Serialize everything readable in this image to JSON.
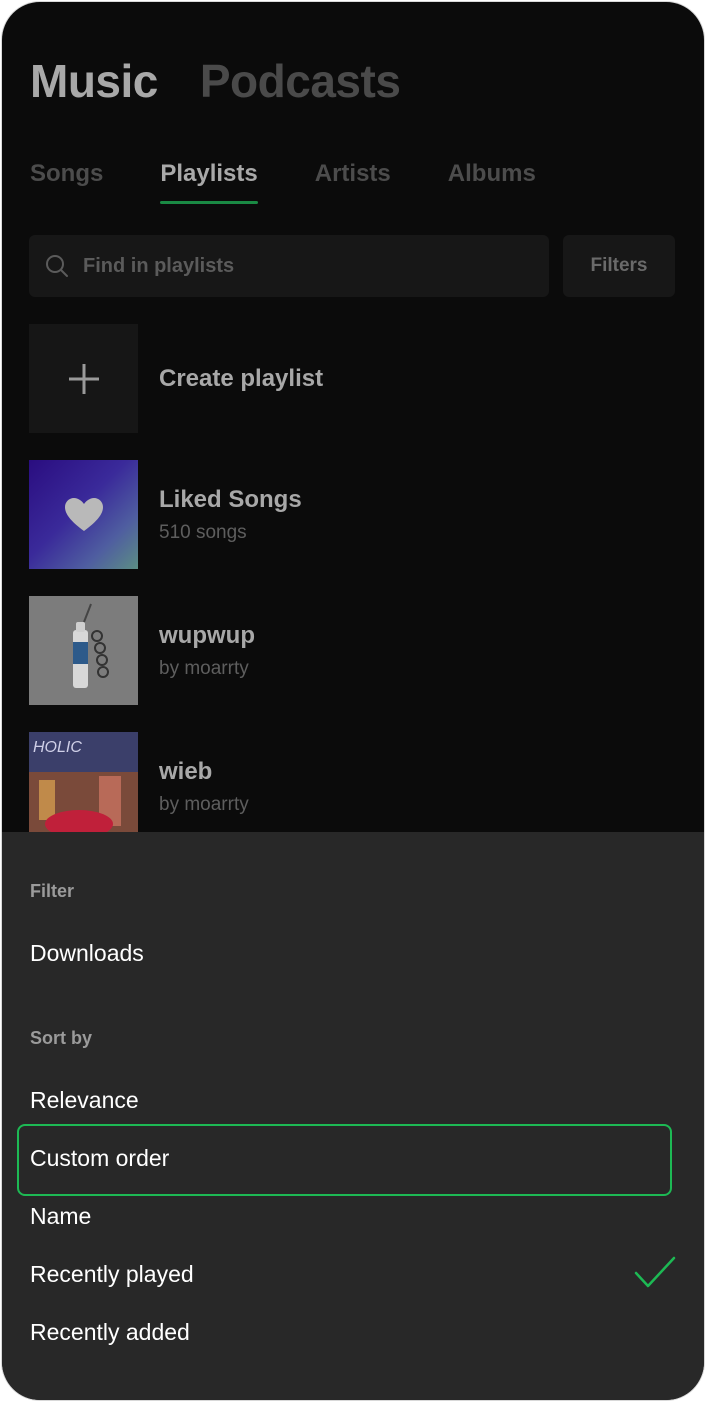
{
  "header": {
    "music": "Music",
    "podcasts": "Podcasts"
  },
  "tabs": [
    {
      "label": "Songs",
      "active": false
    },
    {
      "label": "Playlists",
      "active": true
    },
    {
      "label": "Artists",
      "active": false
    },
    {
      "label": "Albums",
      "active": false
    }
  ],
  "search": {
    "placeholder": "Find in playlists",
    "filters_label": "Filters"
  },
  "playlists": [
    {
      "name": "Create playlist",
      "icon": "plus-icon"
    },
    {
      "name": "Liked Songs",
      "subtitle": "510 songs",
      "icon": "heart-icon"
    },
    {
      "name": "wupwup",
      "subtitle": "by moarrty"
    },
    {
      "name": "wieb",
      "subtitle": "by moarrty",
      "cover_text": "HOLIC"
    }
  ],
  "sheet": {
    "filter_label": "Filter",
    "filter_items": [
      "Downloads"
    ],
    "sort_label": "Sort by",
    "sort_items": [
      "Relevance",
      "Custom order",
      "Name",
      "Recently played",
      "Recently added"
    ],
    "focused_item": "Custom order",
    "selected_item": "Recently played"
  },
  "colors": {
    "accent": "#1db954",
    "tab_underline": "#1a8a44",
    "sheet_bg": "#282828",
    "app_bg": "#0b0b0b"
  }
}
